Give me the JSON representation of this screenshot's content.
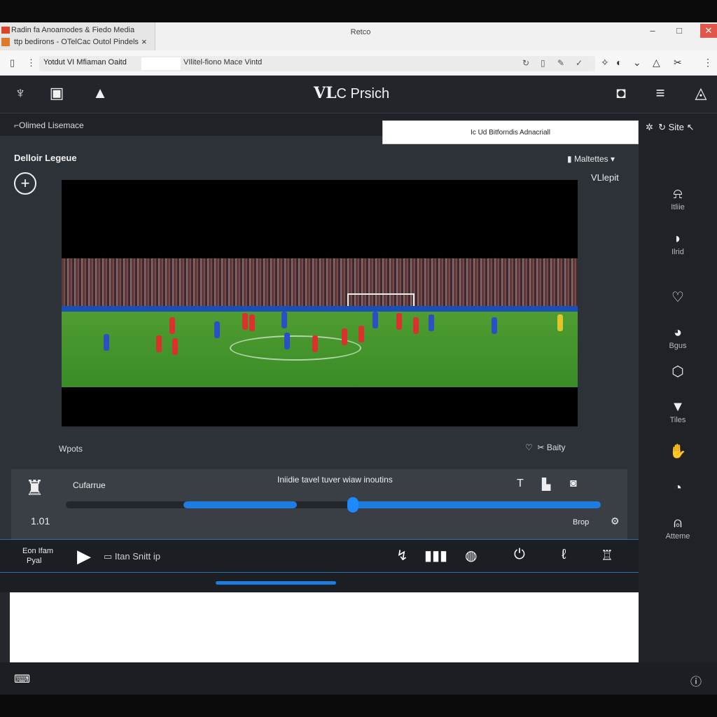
{
  "window": {
    "tab_line1": "Radin fa Anoamodes & Fiedo Media",
    "tab_line2": "ttp bedirons - OTelCac Outol Pindels",
    "tab_close": "×",
    "title": "Retco",
    "minimize": "–",
    "maximize": "□",
    "close": "✕"
  },
  "address": {
    "segment1": "Yotdut VI Mfiaman Oaitd",
    "segment2": "VIlitel-fiono Mace Vintd"
  },
  "app": {
    "title_prefix": "VL",
    "title_rest": "C Prsich"
  },
  "subheader": {
    "label": "Olimed Lisemace",
    "search_text": "Ic Ud Bitforndis Adnacriall"
  },
  "library": {
    "section_title": "Delloir Legeue",
    "mode_select": "Maltettes ▾",
    "vl_label": "VLlepit"
  },
  "video": {
    "footer_left": "Wpots",
    "footer_right": "Baity"
  },
  "timeline": {
    "value": "1.01",
    "name": "Cufarrue",
    "message": "Iniidie tavel tuver wiaw inoutins",
    "progress_start": 0.22,
    "progress_knob": 0.535,
    "speed": "Brop"
  },
  "controls": {
    "left_line1": "Eon Ifam",
    "left_line2": "Pyal",
    "field_text": "Itan Snitt ip"
  },
  "right_panel": {
    "top_label": "Site",
    "items": [
      {
        "icon": "bell-icon",
        "label": "Itliie"
      },
      {
        "icon": "drop-icon",
        "label": "Ilrid"
      },
      {
        "icon": "heart-icon",
        "label": ""
      },
      {
        "icon": "eye-icon",
        "label": "Bgus"
      },
      {
        "icon": "shield-icon",
        "label": ""
      },
      {
        "icon": "filter-icon",
        "label": "Tiles"
      },
      {
        "icon": "hand-icon",
        "label": ""
      },
      {
        "icon": "speed-icon",
        "label": ""
      },
      {
        "icon": "alert-icon",
        "label": "Atteme"
      }
    ]
  },
  "colors": {
    "accent": "#1e7be0",
    "panel": "#2d3138",
    "header": "#22252a"
  }
}
